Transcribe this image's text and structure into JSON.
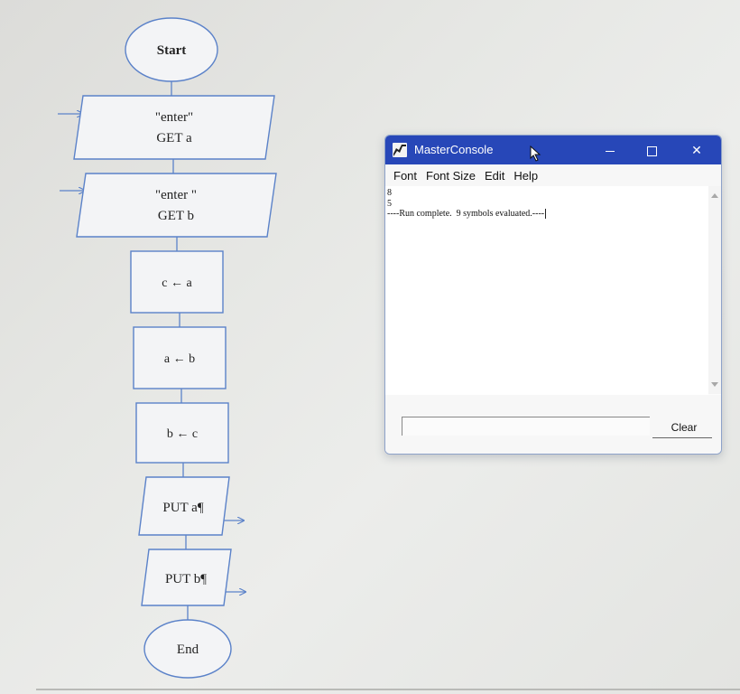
{
  "flowchart": {
    "start_label": "Start",
    "input1": {
      "line1": "\"enter\"",
      "line2": "GET a"
    },
    "input2": {
      "line1": "\"enter \"",
      "line2": "GET b"
    },
    "assign1": "c ← a",
    "assign2": "a ← b",
    "assign3": "b ← c",
    "output1": "PUT a¶",
    "output2": "PUT b¶",
    "end_label": "End"
  },
  "colors": {
    "flow_stroke": "#5b82c9",
    "titlebar": "#2747b8"
  },
  "console": {
    "title": "MasterConsole",
    "icons": {
      "app": "masterconsole-app-icon",
      "minimize": "minimize-icon",
      "maximize": "maximize-icon",
      "close": "close-icon"
    },
    "menu": [
      "Font",
      "Font Size",
      "Edit",
      "Help"
    ],
    "output_lines": [
      "8",
      "5",
      "----Run complete.  9 symbols evaluated.----"
    ],
    "input_value": "",
    "clear_label": "Clear",
    "close_glyph": "✕"
  }
}
